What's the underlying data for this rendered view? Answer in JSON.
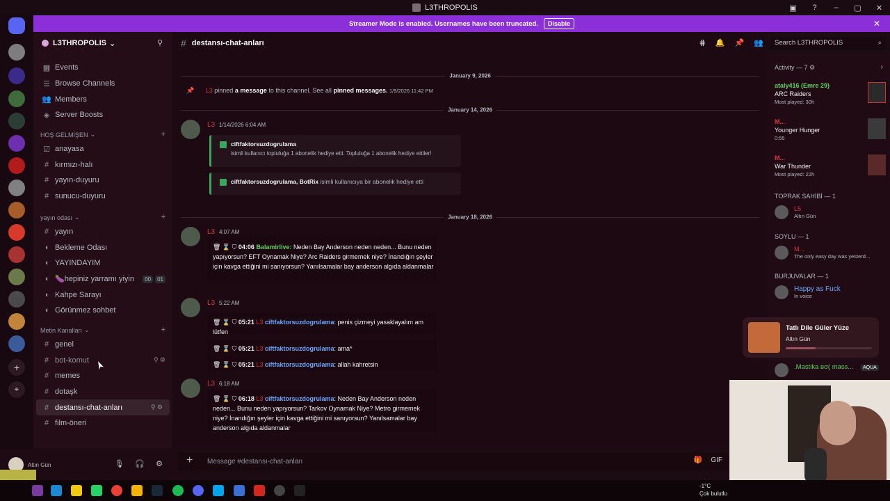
{
  "window": {
    "title": "L3THROPOLIS"
  },
  "banner": {
    "text": "Streamer Mode is enabled. Usernames have been truncated.",
    "button": "Disable"
  },
  "server": {
    "name": "L3THROPOLIS",
    "top_items": [
      {
        "label": "Events",
        "icon": "calendar-icon"
      },
      {
        "label": "Browse Channels",
        "icon": "browse-icon"
      },
      {
        "label": "Members",
        "icon": "members-icon"
      },
      {
        "label": "Server Boosts",
        "icon": "boost-icon"
      }
    ],
    "categories": [
      {
        "name": "HOŞ GELMİŞEN",
        "channels": [
          {
            "label": "anayasa",
            "icon": "rules-icon"
          },
          {
            "label": "kırmızı-halı",
            "icon": "hash-icon"
          },
          {
            "label": "yayın-duyuru",
            "icon": "hash-icon"
          },
          {
            "label": "sunucu-duyuru",
            "icon": "hash-icon"
          }
        ]
      },
      {
        "name": "yayın odası",
        "channels": [
          {
            "label": "yayın",
            "icon": "hash-icon"
          },
          {
            "label": "Bekleme Odası",
            "icon": "voice-icon"
          },
          {
            "label": "YAYINDAYIM",
            "icon": "voice-icon"
          },
          {
            "label": "🍆hepiniz yarramı yiyin",
            "icon": "voice-icon",
            "badge1": "00",
            "badge2": "01"
          },
          {
            "label": "Kahpe Sarayı",
            "icon": "voice-icon"
          },
          {
            "label": "Görünmez sohbet",
            "icon": "voice-icon"
          }
        ]
      },
      {
        "name": "Metin Kanalları",
        "channels": [
          {
            "label": "genel",
            "icon": "hash-icon"
          },
          {
            "label": "bot-komut",
            "icon": "hash-icon"
          },
          {
            "label": "memes",
            "icon": "hash-icon"
          },
          {
            "label": "dotaşk",
            "icon": "hash-icon"
          },
          {
            "label": "destansı-chat-anları",
            "icon": "hash-icon",
            "active": true
          },
          {
            "label": "film-öneri",
            "icon": "hash-icon"
          }
        ]
      }
    ]
  },
  "user": {
    "status": "Altın Gün"
  },
  "channel": {
    "name": "destansı-chat-anları"
  },
  "search": {
    "placeholder": "Search L3THROPOLIS"
  },
  "composer": {
    "placeholder": "Message #destansı-chat-anları"
  },
  "chat": {
    "date1": "January 9, 2026",
    "pin": {
      "name": "L3",
      "text1": "pinned",
      "link1": "a message",
      "text2": "to this channel. See all",
      "link2": "pinned messages.",
      "time": "1/9/2026 11:42 PM"
    },
    "date2": "January 14, 2026",
    "msg1": {
      "name": "L3",
      "time": "1/14/2026 6:04 AM",
      "embed1": {
        "title": "ciftfaktorsuzdogrulama",
        "text": "isimli kullanıcı topluluğa 1 abonelik hediye etti. Topluluğa 1 abonelik hediye ettiler!"
      },
      "embed2": {
        "title": "ciftfaktorsuzdogrulama, BotRix",
        "text": "isimli kullanıcıya bir abonelik hediye etti"
      }
    },
    "date3": "January 18, 2026",
    "msg2": {
      "name": "L3",
      "time": "4:07 AM",
      "ltime": "04:06",
      "user": "Balamirlive:",
      "text": "Neden Bay Anderson neden neden... Bunu neden yapıyorsun? EFT Oynamak Niye? Arc Raiders girmemek niye? İnandığın şeyler için kavga ettiğini mi sanıyorsun? Yanılsamalar bay anderson algıda aldanmalar"
    },
    "msg3": {
      "name": "L3",
      "time": "5:22 AM",
      "l1": {
        "ltime": "05:21",
        "tag": "L3",
        "user": "ciftfaktorsuzdogrulama",
        "text": ": penis çizmeyi yasaklayalım am lütfen"
      },
      "l2": {
        "ltime": "05:21",
        "tag": "L3",
        "user": "ciftfaktorsuzdogrulama",
        "text": ": ama*"
      },
      "l3": {
        "ltime": "05:21",
        "tag": "L3",
        "user": "ciftfaktorsuzdogrulama",
        "text": ": allah kahretsin"
      }
    },
    "msg4": {
      "name": "L3",
      "time": "6:18 AM",
      "ltime": "06:18",
      "tag": "L3",
      "user": "ciftfaktorsuzdogrulama",
      "text": ": Neden Bay Anderson neden neden... Bunu neden yapıyorsun? Tarkov Oynamak Niye? Metro girmemek niye? İnandığın şeyler için kavga ettiğini mi sanıyorsun? Yanılsamalar bay anderson algıda aldanmalar"
    }
  },
  "activity": {
    "title": "Activity — 7",
    "items": [
      {
        "name": "ataly416 (Emre 29)",
        "game": "ARC Raiders",
        "sub": "Most played: 30h"
      },
      {
        "name": "M...",
        "game": "Younger Hunger",
        "sub": "0:55"
      },
      {
        "name": "M...",
        "game": "War Thunder",
        "sub": "Most played: 22h"
      }
    ]
  },
  "member_groups": [
    {
      "title": "TOPRAK SAHİBİ — 1",
      "name": "L5",
      "sub": "Altın Gün"
    },
    {
      "title": "SOYLU — 1",
      "name": "M...",
      "sub": "The only easy day was yesterd..."
    },
    {
      "title": "BURJUVALAR — 1",
      "name": "Happy as Fuck",
      "sub": "In voice"
    }
  ],
  "extra_member": {
    "name": ".Mastika ʙσ( mass...",
    "tag": "AQUA"
  },
  "now_playing": {
    "title": "Tatlı Dile Güler Yüze",
    "artist": "Altın Gün",
    "progress": 0.35
  },
  "taskbar": {
    "temp": "-1°C",
    "weather": "Çok bulutlu"
  },
  "colors": {
    "banner": "#8b2fd8",
    "accent_red": "#d9373d",
    "green": "#5ed15e",
    "blue": "#6fa8ff"
  }
}
